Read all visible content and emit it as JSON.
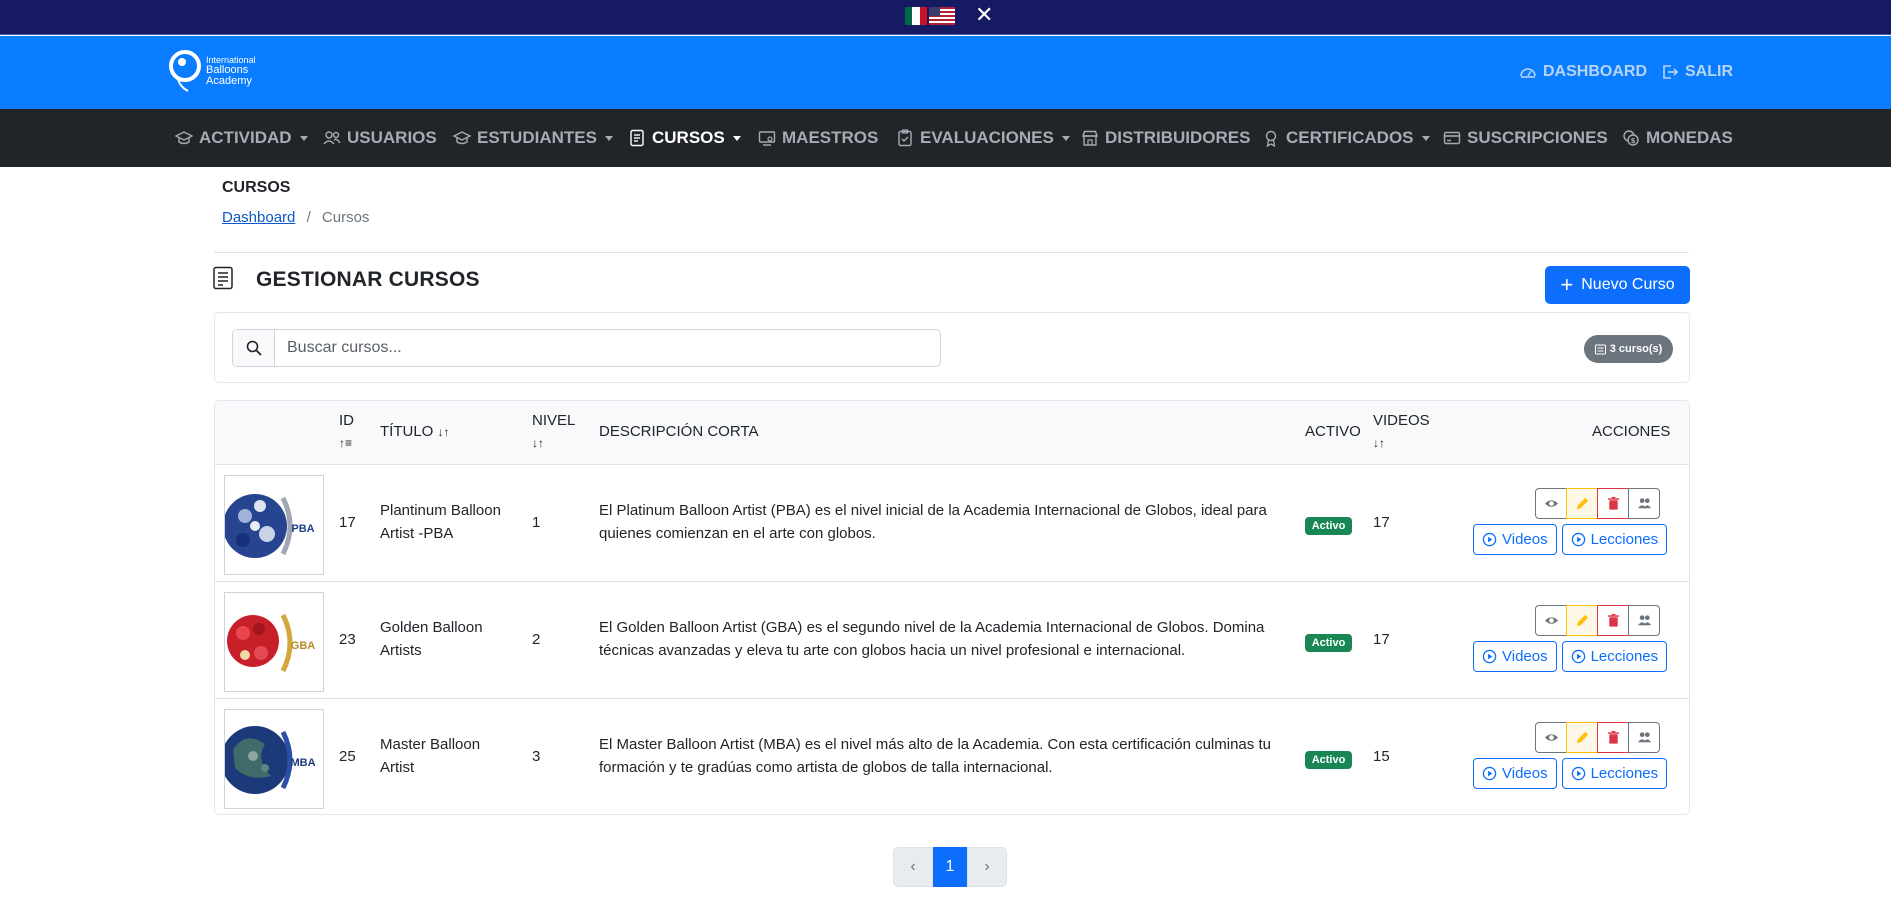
{
  "lang_bar": {
    "close_symbol": "✕"
  },
  "logo": {
    "line1": "International",
    "line2": "Balloons",
    "line3": "Academy"
  },
  "header": {
    "dashboard_label": "DASHBOARD",
    "logout_label": "SALIR"
  },
  "nav": {
    "items": [
      {
        "label": "ACTIVIDAD",
        "icon": "graduation-cap-icon",
        "dropdown": true
      },
      {
        "label": "USUARIOS",
        "icon": "users-icon",
        "dropdown": false
      },
      {
        "label": "ESTUDIANTES",
        "icon": "graduation-cap-icon",
        "dropdown": true
      },
      {
        "label": "CURSOS",
        "icon": "document-icon",
        "dropdown": true,
        "active": true
      },
      {
        "label": "MAESTROS",
        "icon": "presentation-icon",
        "dropdown": false
      },
      {
        "label": "EVALUACIONES",
        "icon": "clipboard-check-icon",
        "dropdown": true
      },
      {
        "label": "DISTRIBUIDORES",
        "icon": "store-icon",
        "dropdown": false
      },
      {
        "label": "CERTIFICADOS",
        "icon": "award-icon",
        "dropdown": true
      },
      {
        "label": "SUSCRIPCIONES",
        "icon": "credit-card-icon",
        "dropdown": false
      },
      {
        "label": "MONEDAS",
        "icon": "coins-icon",
        "dropdown": false
      }
    ]
  },
  "page": {
    "title": "CURSOS",
    "breadcrumb": {
      "home": "Dashboard",
      "separator": "/",
      "current": "Cursos"
    },
    "section_title": "GESTIONAR CURSOS",
    "new_button_label": "Nuevo Curso"
  },
  "search": {
    "placeholder": "Buscar cursos...",
    "value": "",
    "count_label": "3 curso(s)"
  },
  "table": {
    "headers": {
      "id": "ID",
      "title": "TÍTULO",
      "level": "NIVEL",
      "description": "DESCRIPCIÓN CORTA",
      "active": "ACTIVO",
      "videos": "VIDEOS",
      "actions": "ACCIONES"
    },
    "rows": [
      {
        "id": "17",
        "title_line1": "Plantinum Balloon",
        "title_line2": "Artist -PBA",
        "level": "1",
        "desc_line1": "El Platinum Balloon Artist (PBA) es el nivel inicial de la Academia Internacional de Globos, ideal para",
        "desc_line2": "quienes comienzan en el arte con globos.",
        "status": "Activo",
        "videos": "17",
        "thumb_code": "PBA",
        "thumb_color": "#1f3f8f"
      },
      {
        "id": "23",
        "title_line1": "Golden Balloon",
        "title_line2": "Artists",
        "level": "2",
        "desc_line1": "El Golden Balloon Artist (GBA) es el segundo nivel de la Academia Internacional de Globos. Domina",
        "desc_line2": "técnicas avanzadas y eleva tu arte con globos hacia un nivel profesional e internacional.",
        "status": "Activo",
        "videos": "17",
        "thumb_code": "GBA",
        "thumb_color": "#c8202a"
      },
      {
        "id": "25",
        "title_line1": "Master Balloon",
        "title_line2": "Artist",
        "level": "3",
        "desc_line1": "El Master Balloon Artist (MBA) es el nivel más alto de la Academia. Con esta certificación culminas tu",
        "desc_line2": "formación y te gradúas como artista de globos de talla internacional.",
        "status": "Activo",
        "videos": "15",
        "thumb_code": "MBA",
        "thumb_color": "#1c3a7a"
      }
    ],
    "row_buttons": {
      "videos": "Videos",
      "lessons": "Lecciones"
    }
  },
  "pagination": {
    "current": "1",
    "prev_symbol": "‹",
    "next_symbol": "›"
  },
  "colors": {
    "topstrip": "#151a63",
    "header": "#0a7cff",
    "nav": "#212529",
    "primary": "#0d6efd",
    "success": "#198754"
  }
}
